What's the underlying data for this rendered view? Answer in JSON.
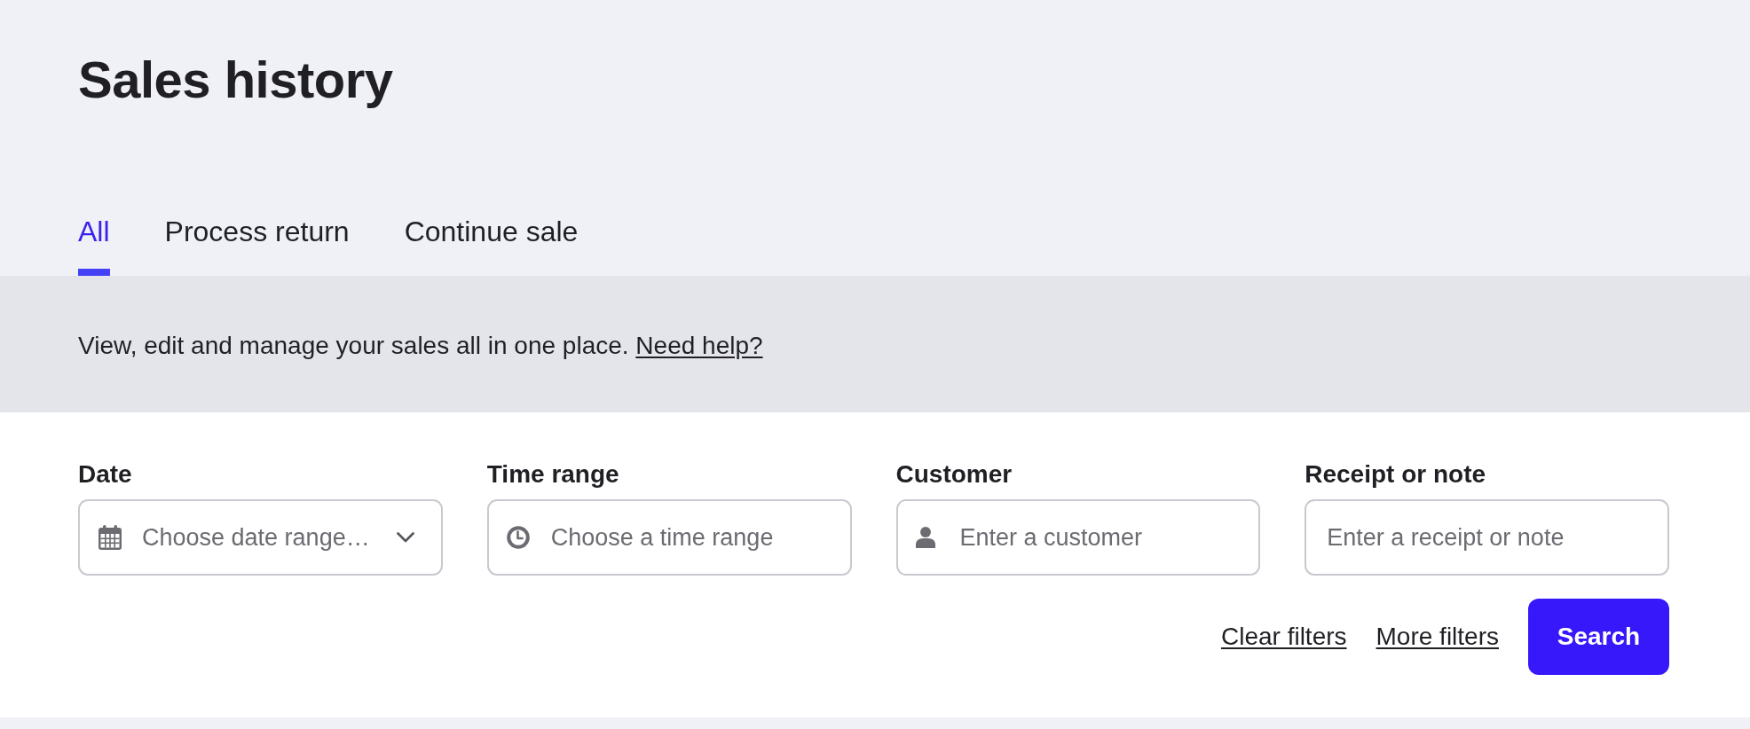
{
  "page": {
    "title": "Sales history"
  },
  "tabs": [
    {
      "label": "All",
      "selected": true
    },
    {
      "label": "Process return",
      "selected": false
    },
    {
      "label": "Continue sale",
      "selected": false
    }
  ],
  "banner": {
    "text": "View, edit and manage your sales all in one place.",
    "link": "Need help?"
  },
  "filters": [
    {
      "kind": "date",
      "label": "Date",
      "placeholder": "Choose date range…"
    },
    {
      "kind": "time",
      "label": "Time range",
      "placeholder": "Choose a time range"
    },
    {
      "kind": "customer",
      "label": "Customer",
      "placeholder": "Enter a customer"
    },
    {
      "kind": "text",
      "label": "Receipt or note",
      "placeholder": "Enter a receipt or note"
    }
  ],
  "actions": [
    {
      "kind": "link",
      "label": "Clear filters"
    },
    {
      "kind": "link",
      "label": "More filters"
    },
    {
      "kind": "button",
      "label": "Search"
    }
  ]
}
